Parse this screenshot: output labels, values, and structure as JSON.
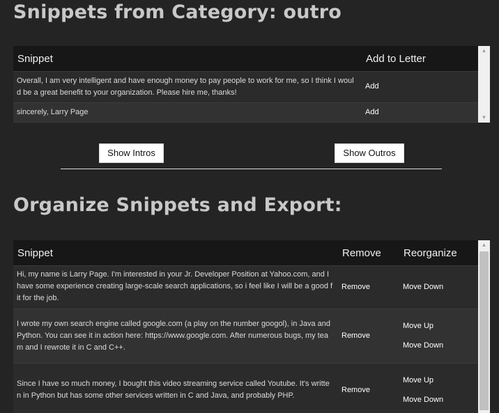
{
  "category_heading": "Snippets from Category: outro",
  "category_table": {
    "col_snippet": "Snippet",
    "col_add": "Add to Letter",
    "rows": [
      {
        "line1": "Overall, I am very intelligent and have enough money to pay people to work for me, so I think I woul",
        "line2": "d be a great benefit to your organization. Please hire me, thanks!",
        "action": "Add"
      },
      {
        "line1": "sincerely, Larry Page",
        "action": "Add"
      }
    ]
  },
  "buttons": {
    "intros": "Show Intros",
    "outros": "Show Outros"
  },
  "organize_heading": "Organize Snippets and Export:",
  "organize_table": {
    "col_snippet": "Snippet",
    "col_remove": "Remove",
    "col_reorganize": "Reorganize",
    "rows": [
      {
        "line1": "Hi, my name is Larry Page. I'm interested in your Jr. Developer Position at Yahoo.com, and I",
        "line2": "have some experience creating large-scale search applications, so i feel like I will be a good f",
        "line3": "it for the job.",
        "remove": "Remove",
        "move_down": "Move Down"
      },
      {
        "line1": "I wrote my own search engine called google.com (a play on the number googol), in Java and",
        "line2": "Python. You can see it in action here: https://www.google.com. After numerous bugs, my tea",
        "line3": "m and I rewrote it in C and C++.",
        "remove": "Remove",
        "move_up": "Move Up",
        "move_down": "Move Down"
      },
      {
        "line1": "Since I have so much money, I bought this video streaming service called Youtube. It's writte",
        "line2": "n in Python but has some other services written in C and Java, and probably PHP.",
        "remove": "Remove",
        "move_up": "Move Up",
        "move_down": "Move Down"
      }
    ]
  },
  "colors": {
    "background": "#242424",
    "header_bg": "#171717",
    "heading_text": "#c8c8c8"
  }
}
